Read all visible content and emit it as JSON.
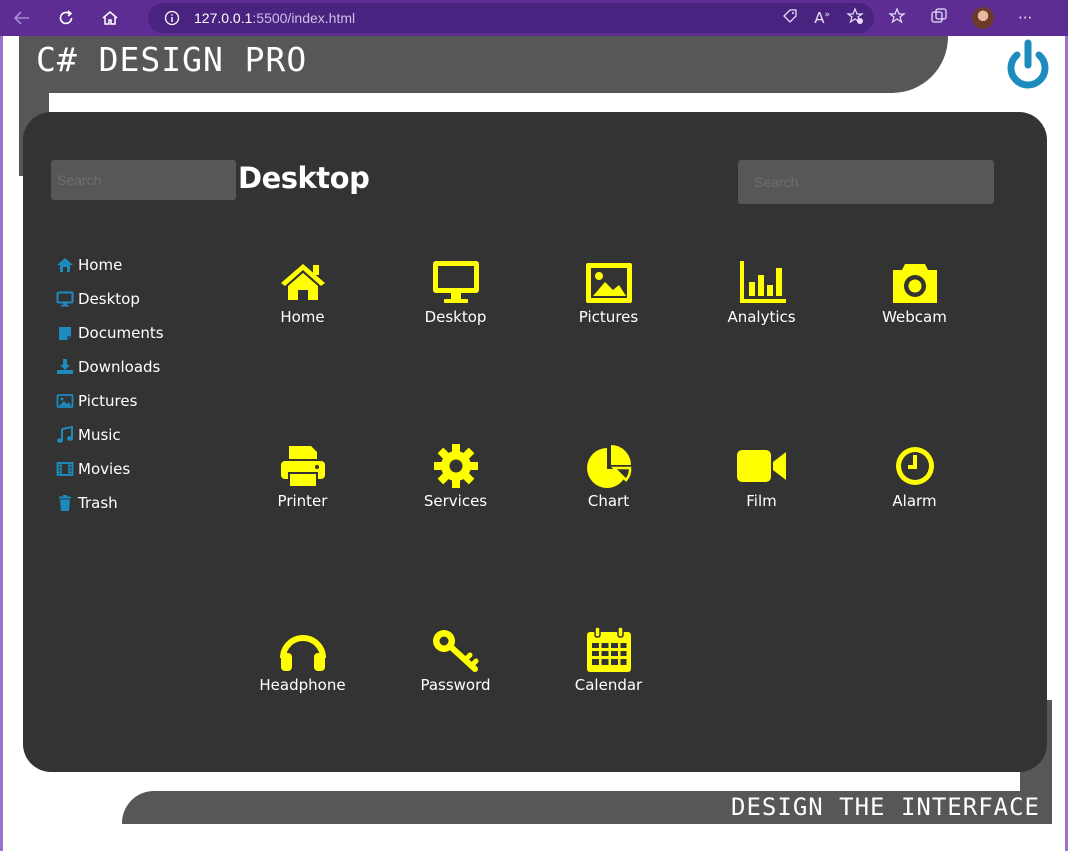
{
  "browser": {
    "url_host": "127.0.0.1",
    "url_path": ":5500/index.html",
    "icons": {
      "back": "back-arrow-icon",
      "refresh": "refresh-icon",
      "home": "home-icon",
      "info": "info-icon",
      "tag": "tag-icon",
      "read_aloud": "read-aloud-icon",
      "favorite_add": "favorite-add-icon",
      "favorites": "favorites-icon",
      "collections": "collections-icon",
      "profile": "profile-avatar",
      "more": "more-icon"
    },
    "accent_color": "#5e2d94"
  },
  "app": {
    "title": "C# DESIGN PRO",
    "footer": "DESIGN THE INTERFACE",
    "power_icon_color": "#1e8bbf"
  },
  "main": {
    "heading": "Desktop",
    "search_left_placeholder": "Search",
    "search_right_placeholder": "Search",
    "panel_color": "#333333",
    "icon_color": "#ffff00"
  },
  "sidebar": {
    "icon_color": "#1e8bbf",
    "items": [
      {
        "label": "Home",
        "icon": "home-icon"
      },
      {
        "label": "Desktop",
        "icon": "desktop-icon"
      },
      {
        "label": "Documents",
        "icon": "document-icon"
      },
      {
        "label": "Downloads",
        "icon": "download-icon"
      },
      {
        "label": "Pictures",
        "icon": "image-icon"
      },
      {
        "label": "Music",
        "icon": "music-icon"
      },
      {
        "label": "Movies",
        "icon": "film-strip-icon"
      },
      {
        "label": "Trash",
        "icon": "trash-icon"
      }
    ]
  },
  "tiles": [
    {
      "label": "Home",
      "icon": "home-icon"
    },
    {
      "label": "Desktop",
      "icon": "desktop-icon"
    },
    {
      "label": "Pictures",
      "icon": "image-icon"
    },
    {
      "label": "Analytics",
      "icon": "bar-chart-icon"
    },
    {
      "label": "Webcam",
      "icon": "camera-icon"
    },
    {
      "label": "Printer",
      "icon": "printer-icon"
    },
    {
      "label": "Services",
      "icon": "gear-icon"
    },
    {
      "label": "Chart",
      "icon": "pie-chart-icon"
    },
    {
      "label": "Film",
      "icon": "video-camera-icon"
    },
    {
      "label": "Alarm",
      "icon": "clock-icon"
    },
    {
      "label": "Headphone",
      "icon": "headphones-icon"
    },
    {
      "label": "Password",
      "icon": "key-icon"
    },
    {
      "label": "Calendar",
      "icon": "calendar-icon"
    }
  ]
}
